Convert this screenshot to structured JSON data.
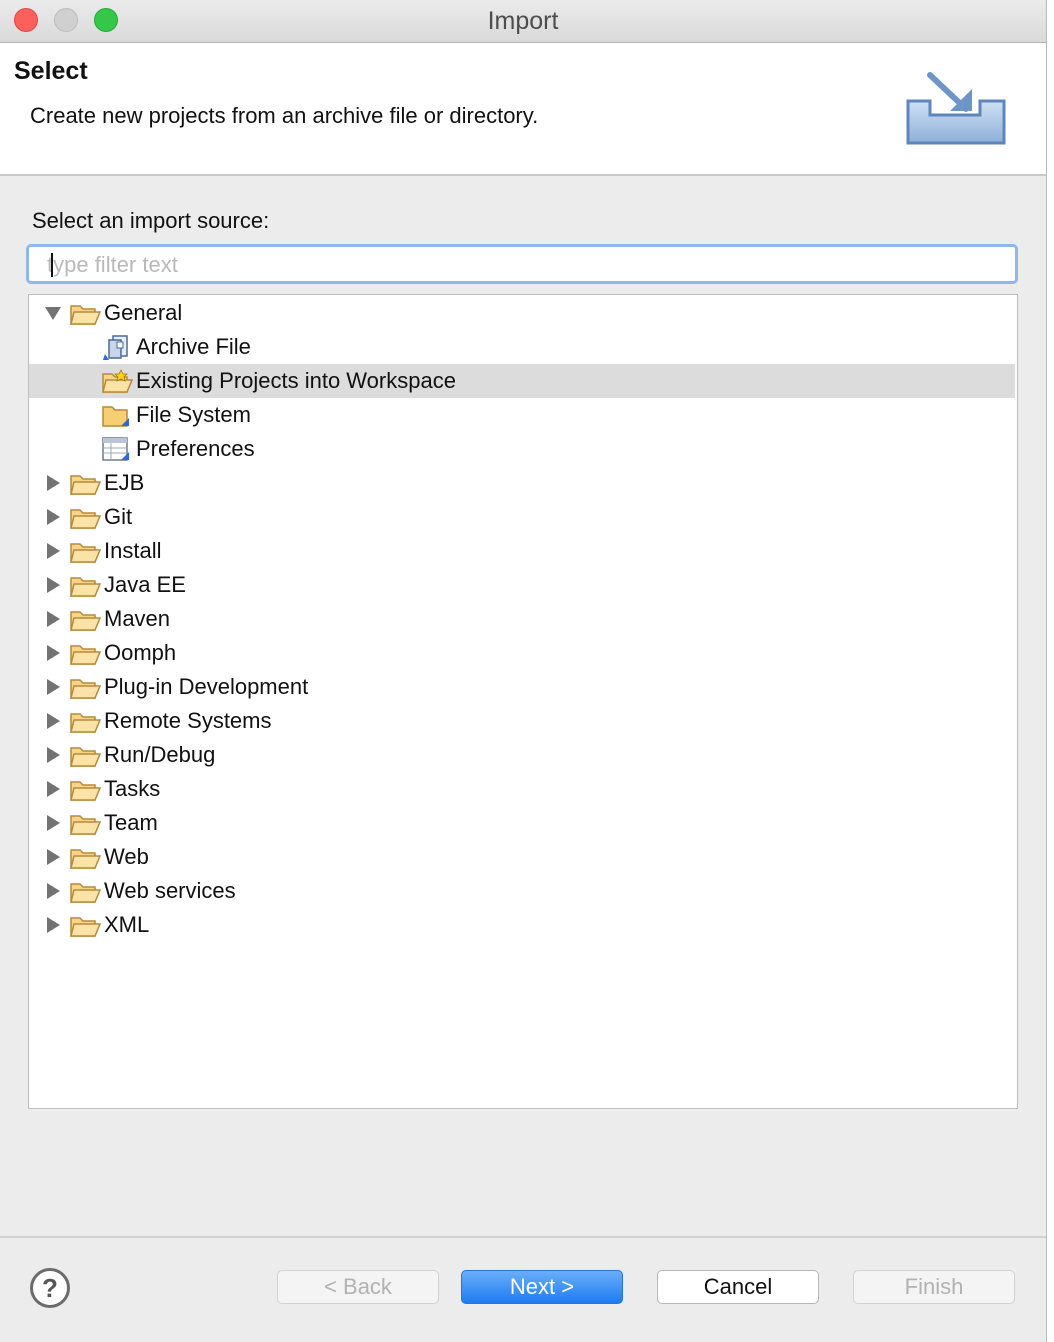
{
  "window": {
    "title": "Import"
  },
  "header": {
    "title": "Select",
    "description": "Create new projects from an archive file or directory."
  },
  "source": {
    "label": "Select an import source:",
    "filter_placeholder": "type filter text",
    "filter_value": ""
  },
  "tree": {
    "items": [
      {
        "label": "General",
        "level": 0,
        "expanded": true,
        "icon": "folder-open-icon"
      },
      {
        "label": "Archive File",
        "level": 1,
        "icon": "archive-file-icon"
      },
      {
        "label": "Existing Projects into Workspace",
        "level": 1,
        "icon": "existing-projects-icon",
        "selected": true
      },
      {
        "label": "File System",
        "level": 1,
        "icon": "file-system-icon"
      },
      {
        "label": "Preferences",
        "level": 1,
        "icon": "preferences-icon"
      },
      {
        "label": "EJB",
        "level": 0,
        "expanded": false,
        "icon": "folder-open-icon"
      },
      {
        "label": "Git",
        "level": 0,
        "expanded": false,
        "icon": "folder-open-icon"
      },
      {
        "label": "Install",
        "level": 0,
        "expanded": false,
        "icon": "folder-open-icon"
      },
      {
        "label": "Java EE",
        "level": 0,
        "expanded": false,
        "icon": "folder-open-icon"
      },
      {
        "label": "Maven",
        "level": 0,
        "expanded": false,
        "icon": "folder-open-icon"
      },
      {
        "label": "Oomph",
        "level": 0,
        "expanded": false,
        "icon": "folder-open-icon"
      },
      {
        "label": "Plug-in Development",
        "level": 0,
        "expanded": false,
        "icon": "folder-open-icon"
      },
      {
        "label": "Remote Systems",
        "level": 0,
        "expanded": false,
        "icon": "folder-open-icon"
      },
      {
        "label": "Run/Debug",
        "level": 0,
        "expanded": false,
        "icon": "folder-open-icon"
      },
      {
        "label": "Tasks",
        "level": 0,
        "expanded": false,
        "icon": "folder-open-icon"
      },
      {
        "label": "Team",
        "level": 0,
        "expanded": false,
        "icon": "folder-open-icon"
      },
      {
        "label": "Web",
        "level": 0,
        "expanded": false,
        "icon": "folder-open-icon"
      },
      {
        "label": "Web services",
        "level": 0,
        "expanded": false,
        "icon": "folder-open-icon"
      },
      {
        "label": "XML",
        "level": 0,
        "expanded": false,
        "icon": "folder-open-icon"
      }
    ]
  },
  "footer": {
    "help_label": "?",
    "back_label": "< Back",
    "next_label": "Next >",
    "cancel_label": "Cancel",
    "finish_label": "Finish"
  },
  "colors": {
    "accent": "#1d7cf2",
    "selection": "#dcdcdc",
    "focus_ring": "#8fb8ee"
  }
}
